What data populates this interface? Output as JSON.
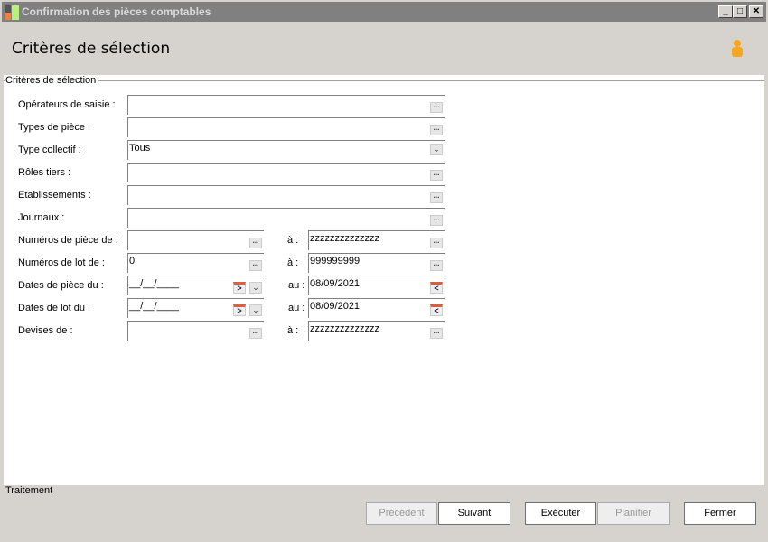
{
  "window": {
    "title": "Confirmation des pièces comptables",
    "minimize": "_",
    "maximize": "□",
    "close": "✕"
  },
  "header": {
    "title": "Critères de sélection"
  },
  "criteria": {
    "legend": "Critères de sélection",
    "operateurs": {
      "label": "Opérateurs de saisie :",
      "value": ""
    },
    "types_piece": {
      "label": "Types de pièce :",
      "value": ""
    },
    "type_collectif": {
      "label": "Type collectif :",
      "value": "Tous"
    },
    "roles_tiers": {
      "label": "Rôles tiers :",
      "value": ""
    },
    "etablissements": {
      "label": "Etablissements :",
      "value": ""
    },
    "journaux": {
      "label": "Journaux :",
      "value": ""
    },
    "num_piece": {
      "label": "Numéros de pièce de :",
      "from": "",
      "sep": "à :",
      "to": "zzzzzzzzzzzzzz"
    },
    "num_lot": {
      "label": "Numéros de lot de :",
      "from": "0",
      "sep": "à :",
      "to": "999999999"
    },
    "dates_piece": {
      "label": "Dates de pièce du :",
      "from": "__/__/____",
      "sep": "au :",
      "to": "08/09/2021"
    },
    "dates_lot": {
      "label": "Dates de lot du :",
      "from": "__/__/____",
      "sep": "au :",
      "to": "08/09/2021"
    },
    "devises": {
      "label": "Devises de :",
      "from": "",
      "sep": "à :",
      "to": "zzzzzzzzzzzzzz"
    }
  },
  "footer": {
    "legend": "Traitement",
    "buttons": {
      "precedent": "Précédent",
      "suivant": "Suivant",
      "executer": "Exécuter",
      "planifier": "Planifier",
      "fermer": "Fermer"
    }
  }
}
